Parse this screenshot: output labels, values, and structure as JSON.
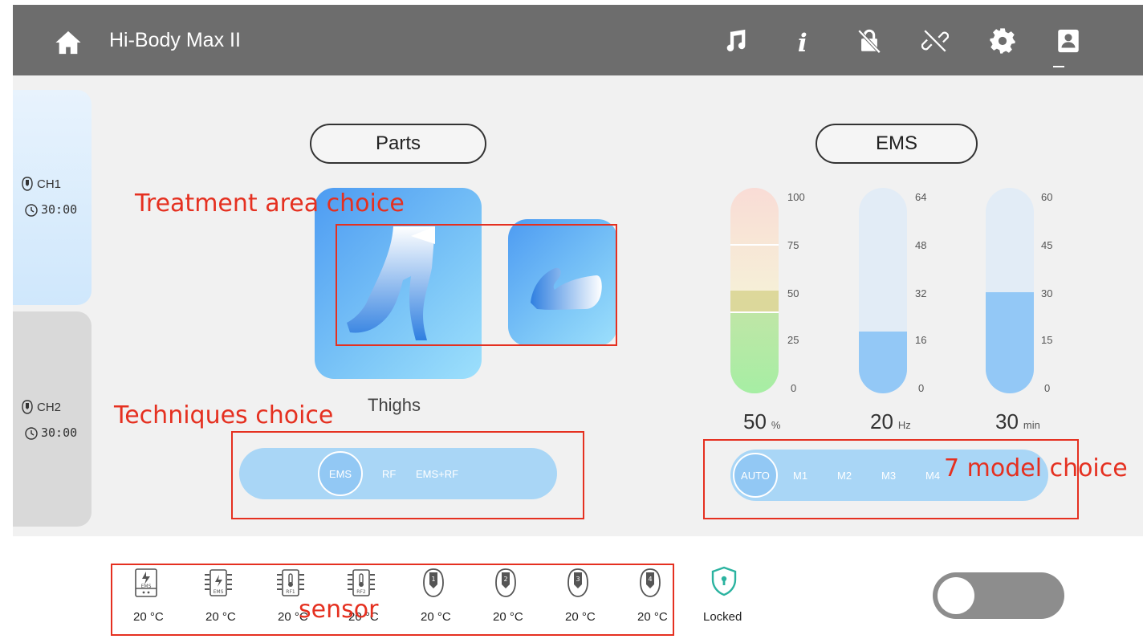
{
  "header": {
    "title": "Hi-Body Max II",
    "icons": [
      "home-icon",
      "music-icon",
      "info-icon",
      "lock-off-icon",
      "link-off-icon",
      "settings-icon",
      "user-profile-icon"
    ]
  },
  "channels": [
    {
      "label": "CH1",
      "time": "30:00"
    },
    {
      "label": "CH2",
      "time": "30:00"
    }
  ],
  "parts": {
    "title": "Parts",
    "selected_label": "Thighs",
    "items": [
      "legs",
      "arm"
    ]
  },
  "techniques": {
    "options": [
      "EMS",
      "RF",
      "EMS+RF"
    ],
    "selected": "EMS"
  },
  "ems": {
    "title": "EMS",
    "intensity": {
      "value": "50",
      "unit": "%",
      "ticks": [
        "100",
        "75",
        "50",
        "25",
        "0"
      ],
      "fraction": 0.5
    },
    "frequency": {
      "value": "20",
      "unit": "Hz",
      "ticks": [
        "64",
        "48",
        "32",
        "16",
        "0"
      ],
      "fraction": 0.3125
    },
    "duration": {
      "value": "30",
      "unit": "min",
      "ticks": [
        "60",
        "45",
        "30",
        "15",
        "0"
      ],
      "fraction": 0.5
    }
  },
  "modes": {
    "options": [
      "AUTO",
      "M1",
      "M2",
      "M3",
      "M4"
    ],
    "selected": "AUTO"
  },
  "sensors": [
    {
      "icon": "ems-module-icon",
      "chip": "EMS",
      "temp": "20 °C"
    },
    {
      "icon": "ems-chip-icon",
      "chip": "EMS",
      "temp": "20 °C"
    },
    {
      "icon": "rf1-chip-icon",
      "chip": "RF1",
      "temp": "20 °C"
    },
    {
      "icon": "rf2-chip-icon",
      "chip": "RF2",
      "temp": "20 °C"
    },
    {
      "icon": "handle-1-icon",
      "chip": "1",
      "temp": "20 °C"
    },
    {
      "icon": "handle-2-icon",
      "chip": "2",
      "temp": "20 °C"
    },
    {
      "icon": "handle-3-icon",
      "chip": "3",
      "temp": "20 °C"
    },
    {
      "icon": "handle-4-icon",
      "chip": "4",
      "temp": "20 °C"
    }
  ],
  "lock": {
    "label": "Locked",
    "color": "#2bb3a0"
  },
  "annotations": {
    "treatment": "Treatment area choice",
    "techniques": "Techniques choice",
    "model": "7 model choice",
    "sensor": "sensor"
  },
  "colors": {
    "header_bg": "#6d6d6d",
    "accent_blue": "#a9d6f6",
    "annotation_red": "#e53020"
  }
}
